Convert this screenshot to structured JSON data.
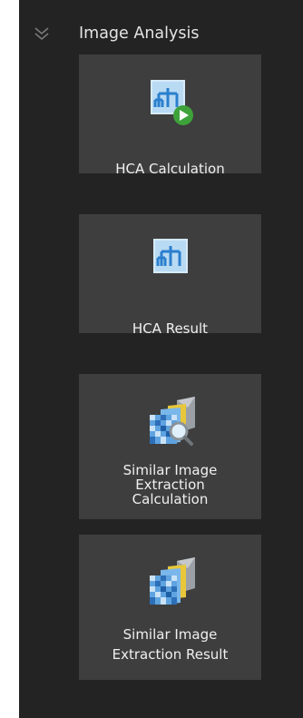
{
  "section": {
    "title": "Image Analysis",
    "collapse_icon": "double-chevron-down-icon"
  },
  "tiles": [
    {
      "icon": "hierarchy-play-icon",
      "lines": [
        "HCA Calculation"
      ]
    },
    {
      "icon": "hierarchy-icon",
      "lines": [
        "HCA Result"
      ]
    },
    {
      "icon": "image-stack-search-icon",
      "lines": [
        "Similar Image",
        "Extraction",
        "Calculation"
      ]
    },
    {
      "icon": "image-stack-icon",
      "lines": [
        "Similar Image",
        "Extraction Result"
      ]
    }
  ],
  "colors": {
    "panel_bg": "#232323",
    "tile_bg": "#3e3e3e",
    "icon_tile": "#3a8fd6",
    "play_green": "#3da23a"
  }
}
